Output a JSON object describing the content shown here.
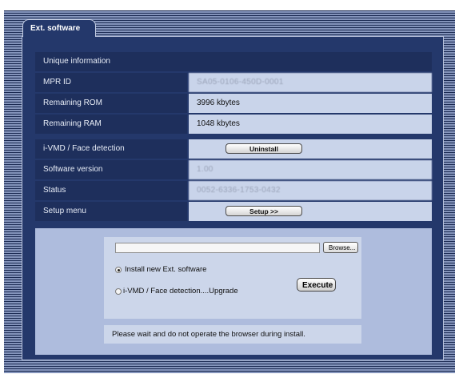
{
  "tab_label": "Ext. software",
  "unique_info": {
    "header": "Unique information",
    "rows": [
      {
        "label": "MPR ID",
        "value": "SA05-0106-450D-0001",
        "obscured": true
      },
      {
        "label": "Remaining ROM",
        "value": "3996 kbytes",
        "obscured": false
      },
      {
        "label": "Remaining RAM",
        "value": "1048 kbytes",
        "obscured": false
      }
    ]
  },
  "software": {
    "name_label": "i-VMD / Face detection",
    "uninstall_button": "Uninstall",
    "version_label": "Software version",
    "version_value": "1.00",
    "status_label": "Status",
    "status_value": "0052-6336-1753-0432",
    "setup_label": "Setup menu",
    "setup_button": "Setup >>"
  },
  "installer": {
    "file_value": "",
    "browse_button": "Browse...",
    "option_install": "Install new Ext. software",
    "option_upgrade": "i-VMD / Face detection....Upgrade",
    "selected_option": "install",
    "execute_button": "Execute",
    "message": "Please wait and do not operate the browser during install."
  },
  "colors": {
    "panel": "#24386b",
    "label_cell": "#1e2f5c",
    "value_cell": "#c9d4ea",
    "lower_area": "#aebcdd"
  }
}
